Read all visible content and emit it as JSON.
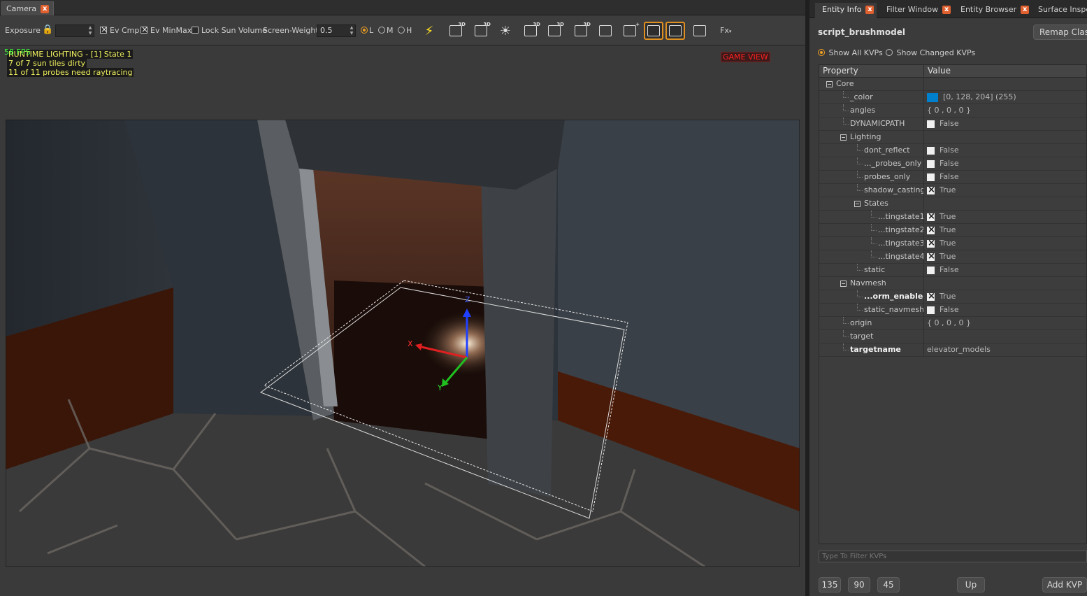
{
  "camera_tab": {
    "label": "Camera",
    "close": "x"
  },
  "toolbar": {
    "exposure_label": "Exposure",
    "exposure_value": "",
    "ev_cmp": {
      "label": "Ev Cmp",
      "checked": true
    },
    "ev_minmax": {
      "label": "Ev MinMax",
      "checked": true
    },
    "lock_sun": {
      "label": "Lock Sun Volume",
      "checked": false
    },
    "screen_weight_label": "Screen-Weight",
    "screen_weight_value": "0.5",
    "lod": [
      {
        "label": "L",
        "selected": true
      },
      {
        "label": "M",
        "selected": false
      },
      {
        "label": "H",
        "selected": false
      }
    ],
    "fx_label": "Fx"
  },
  "viewport": {
    "fps": "58 FPS",
    "overlay_lines": [
      "RUNTIME LIGHTING - [1] State 1",
      "7 of 7 sun tiles dirty",
      "11 of 11 probes need raytracing"
    ],
    "game_view": "GAME VIEW",
    "gizmo": {
      "x": "X",
      "y": "Y",
      "z": "Z"
    }
  },
  "right_tabs": [
    {
      "label": "Entity Info",
      "active": true,
      "close": "x"
    },
    {
      "label": "Filter Window",
      "active": false,
      "close": "x"
    },
    {
      "label": "Entity Browser",
      "active": false,
      "close": "x"
    },
    {
      "label": "Surface Inspe",
      "active": false
    }
  ],
  "entity": {
    "class_name": "script_brushmodel",
    "remap_label": "Remap Class...",
    "show_all": "Show All KVPs",
    "show_changed": "Show Changed KVPs",
    "col_property": "Property",
    "col_value": "Value",
    "filter_placeholder": "Type To Filter KVPs"
  },
  "kv_rows": [
    {
      "key": "Core",
      "value": "",
      "type": "group"
    },
    {
      "key": "_color",
      "value": "[0, 128, 204] (255)",
      "type": "color"
    },
    {
      "key": "angles",
      "value": "{ 0 , 0 , 0 }",
      "type": "text"
    },
    {
      "key": "DYNAMICPATH",
      "value": "False",
      "type": "bool"
    },
    {
      "key": "Lighting",
      "value": "",
      "type": "group"
    },
    {
      "key": "dont_reflect",
      "value": "False",
      "type": "bool"
    },
    {
      "key": "..._probes_only",
      "value": "False",
      "type": "bool"
    },
    {
      "key": "probes_only",
      "value": "False",
      "type": "bool"
    },
    {
      "key": "shadow_casting",
      "value": "True",
      "type": "bool"
    },
    {
      "key": "States",
      "value": "",
      "type": "group"
    },
    {
      "key": "...tingstate1",
      "value": "True",
      "type": "bool"
    },
    {
      "key": "...tingstate2",
      "value": "True",
      "type": "bool"
    },
    {
      "key": "...tingstate3",
      "value": "True",
      "type": "bool"
    },
    {
      "key": "...tingstate4",
      "value": "True",
      "type": "bool"
    },
    {
      "key": "static",
      "value": "False",
      "type": "bool"
    },
    {
      "key": "Navmesh",
      "value": "",
      "type": "group"
    },
    {
      "key": "...orm_enabled",
      "value": "True",
      "type": "bool"
    },
    {
      "key": "static_navmesh",
      "value": "False",
      "type": "bool"
    },
    {
      "key": "origin",
      "value": "{ 0 , 0 , 0 }",
      "type": "text"
    },
    {
      "key": "target",
      "value": "",
      "type": "text"
    },
    {
      "key": "targetname",
      "value": "elevator_models",
      "type": "text"
    }
  ],
  "bottom_buttons": {
    "b135": "135",
    "b90": "90",
    "b45": "45",
    "up": "Up",
    "add_kvp": "Add KVP"
  }
}
